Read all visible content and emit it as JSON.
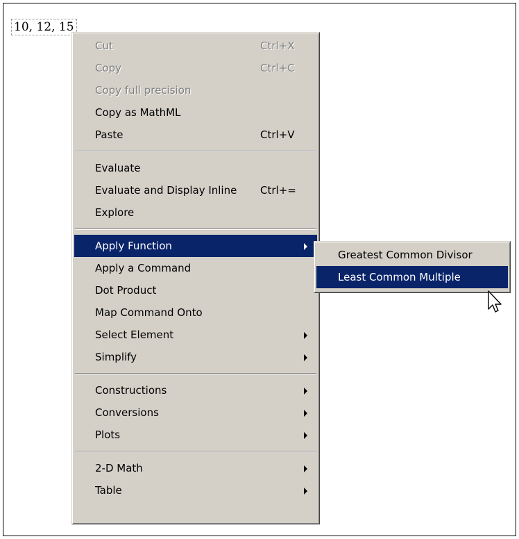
{
  "expression": "10, 12, 15",
  "context_menu": {
    "groups": [
      [
        {
          "label": "Cut",
          "shortcut": "Ctrl+X",
          "disabled": true
        },
        {
          "label": "Copy",
          "shortcut": "Ctrl+C",
          "disabled": true
        },
        {
          "label": "Copy full precision",
          "shortcut": "",
          "disabled": true
        },
        {
          "label": "Copy as MathML",
          "shortcut": "",
          "disabled": false
        },
        {
          "label": "Paste",
          "shortcut": "Ctrl+V",
          "disabled": false
        }
      ],
      [
        {
          "label": "Evaluate",
          "shortcut": ""
        },
        {
          "label": "Evaluate and Display Inline",
          "shortcut": "Ctrl+="
        },
        {
          "label": "Explore",
          "shortcut": ""
        }
      ],
      [
        {
          "label": "Apply Function",
          "submenu": true,
          "selected": true
        },
        {
          "label": "Apply a Command"
        },
        {
          "label": "Dot Product"
        },
        {
          "label": "Map Command Onto"
        },
        {
          "label": "Select Element",
          "submenu": true
        },
        {
          "label": "Simplify",
          "submenu": true
        }
      ],
      [
        {
          "label": "Constructions",
          "submenu": true
        },
        {
          "label": "Conversions",
          "submenu": true
        },
        {
          "label": "Plots",
          "submenu": true
        }
      ],
      [
        {
          "label": "2-D Math",
          "submenu": true
        },
        {
          "label": "Table",
          "submenu": true
        }
      ]
    ]
  },
  "submenu": {
    "items": [
      {
        "label": "Greatest Common Divisor",
        "selected": false
      },
      {
        "label": "Least Common Multiple",
        "selected": true
      }
    ]
  },
  "colors": {
    "menu_bg": "#d4d0c8",
    "highlight_bg": "#0a246a",
    "highlight_text": "#ffffff",
    "disabled_text": "#808080"
  },
  "icons": {
    "submenu_arrow": "triangle-right",
    "pointer": "mouse-pointer-arrow"
  }
}
